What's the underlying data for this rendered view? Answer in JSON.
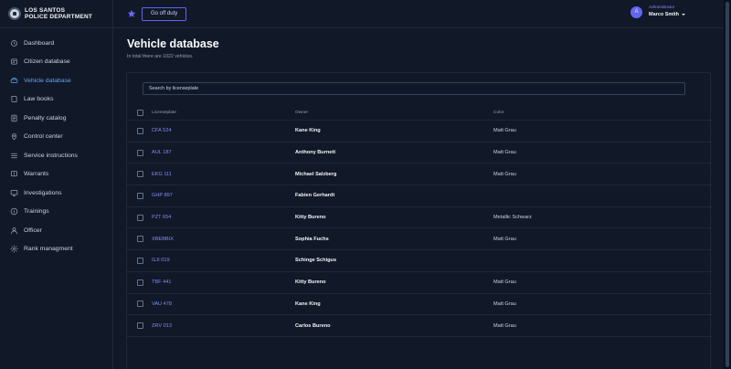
{
  "brand": {
    "line1": "LOS SANTOS",
    "line2": "POLICE DEPARTMENT"
  },
  "sidebar": {
    "items": [
      {
        "label": "Dashboard",
        "icon": "dashboard-icon",
        "active": false
      },
      {
        "label": "Citizen database",
        "icon": "citizen-icon",
        "active": false
      },
      {
        "label": "Vehicle database",
        "icon": "car-icon",
        "active": true
      },
      {
        "label": "Law books",
        "icon": "book-icon",
        "active": false
      },
      {
        "label": "Penalty catalog",
        "icon": "catalog-icon",
        "active": false
      },
      {
        "label": "Control center",
        "icon": "location-icon",
        "active": false
      },
      {
        "label": "Service instructions",
        "icon": "list-icon",
        "active": false
      },
      {
        "label": "Warrants",
        "icon": "warrant-icon",
        "active": false
      },
      {
        "label": "Investigations",
        "icon": "monitor-icon",
        "active": false
      },
      {
        "label": "Trainings",
        "icon": "info-icon",
        "active": false
      },
      {
        "label": "Officer",
        "icon": "user-icon",
        "active": false
      },
      {
        "label": "Rank managment",
        "icon": "gear-icon",
        "active": false
      }
    ]
  },
  "topbar": {
    "offduty_label": "Go off duty",
    "star_icon": "star-icon"
  },
  "user": {
    "initial": "A",
    "role": "Administrator",
    "name": "Marco Smith"
  },
  "main": {
    "title": "Vehicle database",
    "subtitle": "In total there are 1022 vehicles.",
    "search_placeholder": "Search by licenseplate"
  },
  "table": {
    "headers": {
      "plate": "Licenseplate",
      "owner": "Owner",
      "color": "Color"
    },
    "rows": [
      {
        "plate": "CFA 524",
        "owner": "Kane King",
        "color": "Matt Grau"
      },
      {
        "plate": "AUL 187",
        "owner": "Anthony Burnett",
        "color": "Matt Grau"
      },
      {
        "plate": "EKG 111",
        "owner": "Michael Salzberg",
        "color": "Matt Grau"
      },
      {
        "plate": "GHP 897",
        "owner": "Fabien Gerhardt",
        "color": ""
      },
      {
        "plate": "PZT 654",
        "owner": "Kitty Bureno",
        "color": "Metallic Schwarz"
      },
      {
        "plate": "XBEBBIX",
        "owner": "Sophia Fuchs",
        "color": "Matt Grau"
      },
      {
        "plate": "GJI 019",
        "owner": "Schinge Schigus",
        "color": ""
      },
      {
        "plate": "TBF 441",
        "owner": "Kitty Bureno",
        "color": "Matt Grau"
      },
      {
        "plate": "VAU 478",
        "owner": "Kane King",
        "color": "Matt Grau"
      },
      {
        "plate": "ZRV 013",
        "owner": "Carlos Bureno",
        "color": "Matt Grau"
      }
    ]
  },
  "colors": {
    "accent": "#6366f1",
    "active_nav": "#60a5fa",
    "background": "#111827"
  }
}
